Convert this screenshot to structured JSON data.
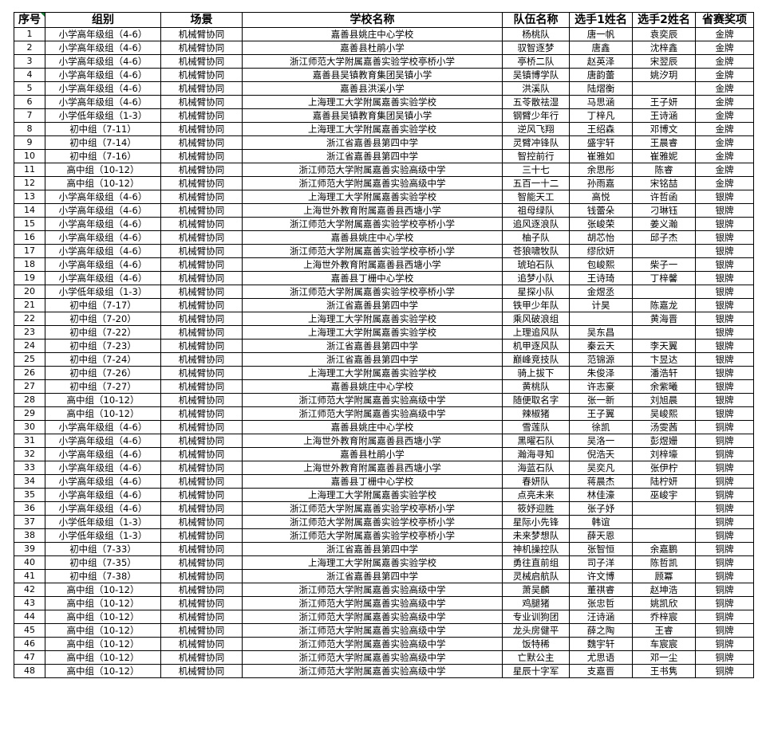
{
  "table": {
    "headers": [
      "序号",
      "组别",
      "场景",
      "学校名称",
      "队伍名称",
      "选手1姓名",
      "选手2姓名",
      "省赛奖项"
    ],
    "rows": [
      [
        "1",
        "小学高年级组（4-6）",
        "机械臂协同",
        "嘉善县姚庄中心学校",
        "杨桃队",
        "唐一帆",
        "袁奕辰",
        "金牌"
      ],
      [
        "2",
        "小学高年级组（4-6）",
        "机械臂协同",
        "嘉善县杜鹃小学",
        "驭智逐梦",
        "唐鑫",
        "沈梓鑫",
        "金牌"
      ],
      [
        "3",
        "小学高年级组（4-6）",
        "机械臂协同",
        "浙江师范大学附属嘉善实验学校亭桥小学",
        "亭桥二队",
        "赵英泽",
        "宋翌辰",
        "金牌"
      ],
      [
        "4",
        "小学高年级组（4-6）",
        "机械臂协同",
        "嘉善县吴镇教育集团吴镇小学",
        "吴镇博学队",
        "唐韵蕾",
        "姚汐玥",
        "金牌"
      ],
      [
        "5",
        "小学高年级组（4-6）",
        "机械臂协同",
        "嘉善县洪溪小学",
        "洪溪队",
        "陆熠衡",
        "",
        "金牌"
      ],
      [
        "6",
        "小学高年级组（4-6）",
        "机械臂协同",
        "上海理工大学附属嘉善实验学校",
        "五苓散祛湿",
        "马思涵",
        "王子妍",
        "金牌"
      ],
      [
        "7",
        "小学低年级组（1-3）",
        "机械臂协同",
        "嘉善县吴镇教育集团吴镇小学",
        "钢臂少年行",
        "丁梓凡",
        "王诗涵",
        "金牌"
      ],
      [
        "8",
        "初中组（7-11）",
        "机械臂协同",
        "上海理工大学附属嘉善实验学校",
        "逆风飞翔",
        "王绍森",
        "邓博文",
        "金牌"
      ],
      [
        "9",
        "初中组（7-14）",
        "机械臂协同",
        "浙江省嘉善县第四中学",
        "灵臂冲锋队",
        "盛宇轩",
        "王晨睿",
        "金牌"
      ],
      [
        "10",
        "初中组（7-16）",
        "机械臂协同",
        "浙江省嘉善县第四中学",
        "智控前行",
        "崔雅如",
        "崔雅妮",
        "金牌"
      ],
      [
        "11",
        "高中组（10-12）",
        "机械臂协同",
        "浙江师范大学附属嘉善实验高级中学",
        "三十七",
        "余思彤",
        "陈睿",
        "金牌"
      ],
      [
        "12",
        "高中组（10-12）",
        "机械臂协同",
        "浙江师范大学附属嘉善实验高级中学",
        "五百一十二",
        "孙雨嘉",
        "宋铭喆",
        "金牌"
      ],
      [
        "13",
        "小学高年级组（4-6）",
        "机械臂协同",
        "上海理工大学附属嘉善实验学校",
        "智能天工",
        "高悦",
        "许哲函",
        "银牌"
      ],
      [
        "14",
        "小学高年级组（4-6）",
        "机械臂协同",
        "上海世外教育附属嘉善县西塘小学",
        "祖母绿队",
        "钱蕾朵",
        "刁琳钰",
        "银牌"
      ],
      [
        "15",
        "小学高年级组（4-6）",
        "机械臂协同",
        "浙江师范大学附属嘉善实验学校亭桥小学",
        "追风逐浪队",
        "张峻荣",
        "姜义瀚",
        "银牌"
      ],
      [
        "16",
        "小学高年级组（4-6）",
        "机械臂协同",
        "嘉善县姚庄中心学校",
        "柚子队",
        "胡芯怡",
        "邱子杰",
        "银牌"
      ],
      [
        "17",
        "小学高年级组（4-6）",
        "机械臂协同",
        "浙江师范大学附属嘉善实验学校亭桥小学",
        "苍狼啸牧队",
        "缪欣妍",
        "",
        "银牌"
      ],
      [
        "18",
        "小学高年级组（4-6）",
        "机械臂协同",
        "上海世外教育附属嘉善县西塘小学",
        "琥珀石队",
        "包峻熙",
        "柴子一",
        "银牌"
      ],
      [
        "19",
        "小学高年级组（4-6）",
        "机械臂协同",
        "嘉善县丁栅中心学校",
        "追梦小队",
        "王诗琦",
        "丁梓馨",
        "银牌"
      ],
      [
        "20",
        "小学低年级组（1-3）",
        "机械臂协同",
        "浙江师范大学附属嘉善实验学校亭桥小学",
        "星探小队",
        "金煜丞",
        "",
        "银牌"
      ],
      [
        "21",
        "初中组（7-17）",
        "机械臂协同",
        "浙江省嘉善县第四中学",
        "铁甲少年队",
        "计昊",
        "陈嘉龙",
        "银牌"
      ],
      [
        "22",
        "初中组（7-20）",
        "机械臂协同",
        "上海理工大学附属嘉善实验学校",
        "乘风破浪组",
        "",
        "黄海晋",
        "银牌"
      ],
      [
        "23",
        "初中组（7-22）",
        "机械臂协同",
        "上海理工大学附属嘉善实验学校",
        "上理追风队",
        "吴东昌",
        "",
        "银牌"
      ],
      [
        "24",
        "初中组（7-23）",
        "机械臂协同",
        "浙江省嘉善县第四中学",
        "机甲逐风队",
        "秦云天",
        "李天翼",
        "银牌"
      ],
      [
        "25",
        "初中组（7-24）",
        "机械臂协同",
        "浙江省嘉善县第四中学",
        "巅峰竞技队",
        "范锦源",
        "卞昱达",
        "银牌"
      ],
      [
        "26",
        "初中组（7-26）",
        "机械臂协同",
        "上海理工大学附属嘉善实验学校",
        "骑上拔下",
        "朱俊泽",
        "潘浩轩",
        "银牌"
      ],
      [
        "27",
        "初中组（7-27）",
        "机械臂协同",
        "嘉善县姚庄中心学校",
        "黄桃队",
        "许志豪",
        "余紫曦",
        "银牌"
      ],
      [
        "28",
        "高中组（10-12）",
        "机械臂协同",
        "浙江师范大学附属嘉善实验高级中学",
        "随便取名字",
        "张一新",
        "刘旭晨",
        "银牌"
      ],
      [
        "29",
        "高中组（10-12）",
        "机械臂协同",
        "浙江师范大学附属嘉善实验高级中学",
        "辣椒猪",
        "王子翼",
        "吴峻熙",
        "银牌"
      ],
      [
        "30",
        "小学高年级组（4-6）",
        "机械臂协同",
        "嘉善县姚庄中心学校",
        "雪莲队",
        "徐凯",
        "汤雯茜",
        "铜牌"
      ],
      [
        "31",
        "小学高年级组（4-6）",
        "机械臂协同",
        "上海世外教育附属嘉善县西塘小学",
        "黑曜石队",
        "吴洛一",
        "彭煜姗",
        "铜牌"
      ],
      [
        "32",
        "小学高年级组（4-6）",
        "机械臂协同",
        "嘉善县杜鹃小学",
        "瀚海寻知",
        "倪浩天",
        "刘梓壕",
        "铜牌"
      ],
      [
        "33",
        "小学高年级组（4-6）",
        "机械臂协同",
        "上海世外教育附属嘉善县西塘小学",
        "海蓝石队",
        "吴奕凡",
        "张伊柠",
        "铜牌"
      ],
      [
        "34",
        "小学高年级组（4-6）",
        "机械臂协同",
        "嘉善县丁栅中心学校",
        "春妍队",
        "蒋晨杰",
        "陆柠妍",
        "铜牌"
      ],
      [
        "35",
        "小学高年级组（4-6）",
        "机械臂协同",
        "上海理工大学附属嘉善实验学校",
        "点亮未来",
        "林佳濠",
        "巫峻宇",
        "铜牌"
      ],
      [
        "36",
        "小学高年级组（4-6）",
        "机械臂协同",
        "浙江师范大学附属嘉善实验学校亭桥小学",
        "筱妤迎胜",
        "张子妤",
        "",
        "铜牌"
      ],
      [
        "37",
        "小学低年级组（1-3）",
        "机械臂协同",
        "浙江师范大学附属嘉善实验学校亭桥小学",
        "星际小先锋",
        "韩谊",
        "",
        "铜牌"
      ],
      [
        "38",
        "小学低年级组（1-3）",
        "机械臂协同",
        "浙江师范大学附属嘉善实验学校亭桥小学",
        "未来梦想队",
        "薛天恩",
        "",
        "铜牌"
      ],
      [
        "39",
        "初中组（7-33）",
        "机械臂协同",
        "浙江省嘉善县第四中学",
        "神机操控队",
        "张智恒",
        "余嘉鹏",
        "铜牌"
      ],
      [
        "40",
        "初中组（7-35）",
        "机械臂协同",
        "上海理工大学附属嘉善实验学校",
        "勇往直前组",
        "司子洋",
        "陈哲凯",
        "铜牌"
      ],
      [
        "41",
        "初中组（7-38）",
        "机械臂协同",
        "浙江省嘉善县第四中学",
        "灵械启航队",
        "许文博",
        "顾冪",
        "铜牌"
      ],
      [
        "42",
        "高中组（10-12）",
        "机械臂协同",
        "浙江师范大学附属嘉善实验高级中学",
        "萧吴麟",
        "董祺睿",
        "赵坤浩",
        "铜牌"
      ],
      [
        "43",
        "高中组（10-12）",
        "机械臂协同",
        "浙江师范大学附属嘉善实验高级中学",
        "鸡腿猪",
        "张忠哲",
        "姚凯欣",
        "铜牌"
      ],
      [
        "44",
        "高中组（10-12）",
        "机械臂协同",
        "浙江师范大学附属嘉善实验高级中学",
        "专业训狗团",
        "汪诗涵",
        "乔梓宸",
        "铜牌"
      ],
      [
        "45",
        "高中组（10-12）",
        "机械臂协同",
        "浙江师范大学附属嘉善实验高级中学",
        "龙头房健平",
        "薛之陶",
        "王睿",
        "铜牌"
      ],
      [
        "46",
        "高中组（10-12）",
        "机械臂协同",
        "浙江师范大学附属嘉善实验高级中学",
        "饭特稀",
        "魏宇轩",
        "车宸宸",
        "铜牌"
      ],
      [
        "47",
        "高中组（10-12）",
        "机械臂协同",
        "浙江师范大学附属嘉善实验高级中学",
        "亡默公主",
        "尤思语",
        "邓一尘",
        "铜牌"
      ],
      [
        "48",
        "高中组（10-12）",
        "机械臂协同",
        "浙江师范大学附属嘉善实验高级中学",
        "星辰十字军",
        "支嘉晋",
        "王书隽",
        "铜牌"
      ]
    ]
  }
}
